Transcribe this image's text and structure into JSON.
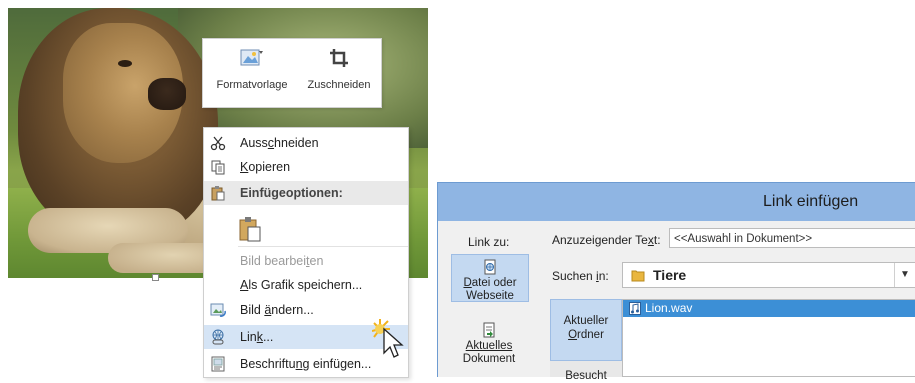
{
  "mini_toolbar": {
    "style_label": "Formatvorlage",
    "crop_label": "Zuschneiden"
  },
  "context_menu": {
    "cut": {
      "pre": "Auss",
      "ul": "c",
      "post": "hneiden"
    },
    "copy": {
      "pre": "",
      "ul": "K",
      "post": "opieren"
    },
    "paste_header": "Einfügeoptionen:",
    "edit_picture": {
      "pre": "Bild bearbei",
      "ul": "t",
      "post": "en"
    },
    "save_as_picture": {
      "pre": "",
      "ul": "A",
      "post": "ls Grafik speichern..."
    },
    "change_picture": {
      "pre": "Bild ",
      "ul": "ä",
      "post": "ndern..."
    },
    "link": {
      "pre": "Lin",
      "ul": "k",
      "post": "..."
    },
    "insert_caption": {
      "pre": "Beschriftu",
      "ul": "n",
      "post": "g einfügen..."
    }
  },
  "dialog": {
    "title": "Link einfügen",
    "link_to_label": "Link zu:",
    "display_text": {
      "pre": "Anzuzeigender Te",
      "ul": "x",
      "post": "t:"
    },
    "display_text_value": "<<Auswahl in Dokument>>",
    "look_in": {
      "pre": "Suchen ",
      "ul": "i",
      "post": "n:"
    },
    "look_in_value": "Tiere",
    "nav": {
      "file_or_web": {
        "pre": "",
        "ul": "D",
        "post": "atei oder",
        "line2": "Webseite"
      },
      "this_document": {
        "line1": "Aktuelles",
        "line2": "Dokument"
      }
    },
    "subnav": {
      "current_folder": {
        "line1": "Aktueller",
        "pre": "",
        "ul": "O",
        "post": "rdner"
      },
      "browsed": "Besucht"
    },
    "files": [
      "Lion.wav"
    ]
  },
  "colors": {
    "dialog_title_bg": "#8fb5e3",
    "selection_blue": "#3c8fd6",
    "menu_highlight": "#d5e4f5"
  }
}
